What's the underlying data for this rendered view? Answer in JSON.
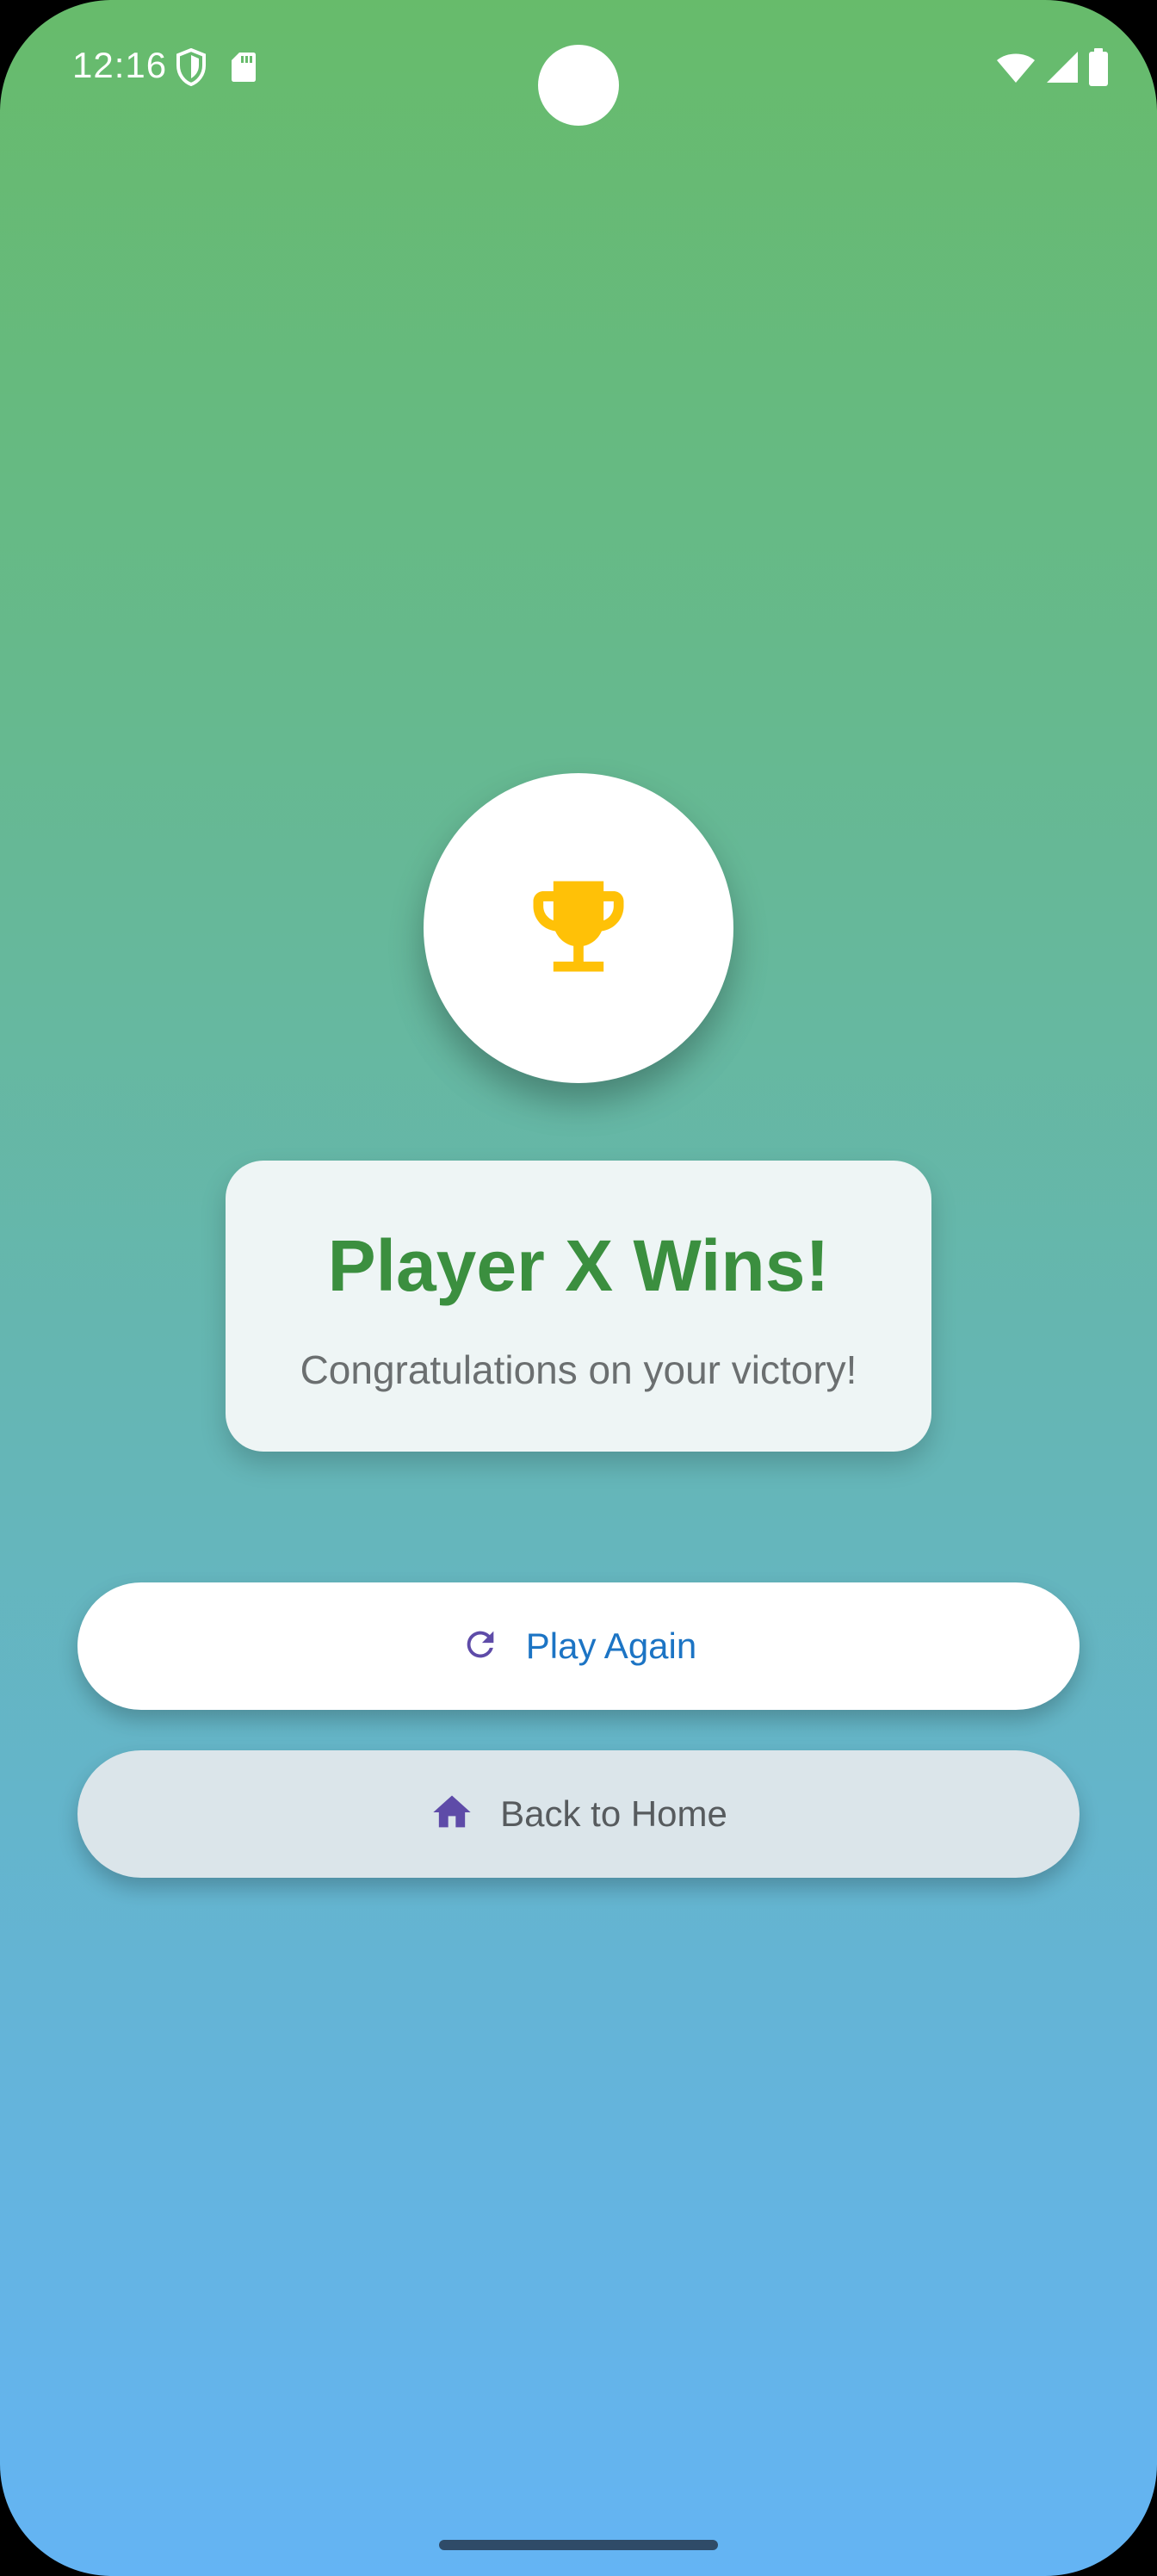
{
  "status_bar": {
    "time": "12:16",
    "left_icons": [
      "shield-icon",
      "sd-card-icon"
    ],
    "right_icons": [
      "wifi-icon",
      "cellular-signal-icon",
      "battery-icon"
    ]
  },
  "trophy": {
    "icon": "trophy-icon",
    "color": "#FFC107"
  },
  "result": {
    "title": "Player X Wins!",
    "subtitle": "Congratulations on your victory!",
    "title_color": "#3B8F3F"
  },
  "actions": {
    "play_again": {
      "label": "Play Again",
      "icon": "refresh-icon",
      "icon_color": "#5E4BA8",
      "label_color": "#1C74C4"
    },
    "back_home": {
      "label": "Back to Home",
      "icon": "home-icon",
      "icon_color": "#5E4BA8",
      "label_color": "#575B5E"
    }
  },
  "theme": {
    "gradient_top": "#67BB6B",
    "gradient_bottom": "#64B4F4"
  }
}
